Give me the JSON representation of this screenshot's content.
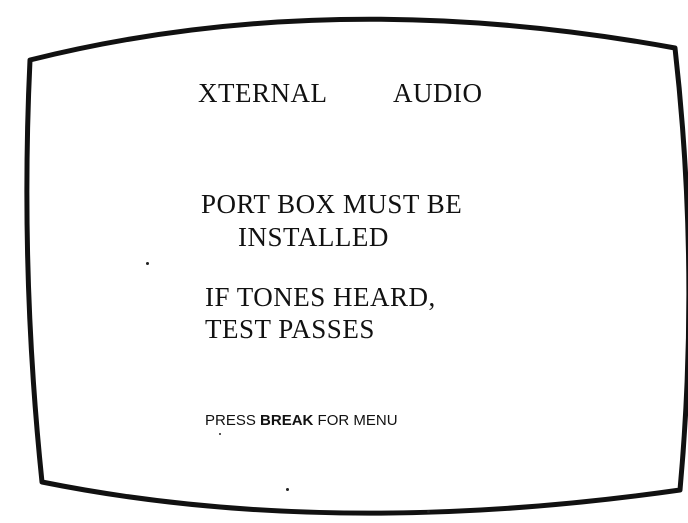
{
  "screen": {
    "title_left": "XTERNAL",
    "title_right": "AUDIO",
    "lines": [
      "PORT BOX MUST BE",
      "INSTALLED",
      "IF TONES HEARD,",
      "TEST PASSES"
    ],
    "footer": {
      "press": "PRESS ",
      "key": "BREAK",
      "rest": " FOR MENU"
    }
  },
  "colors": {
    "text": "#111111",
    "frame": "#111111",
    "background": "#ffffff"
  }
}
